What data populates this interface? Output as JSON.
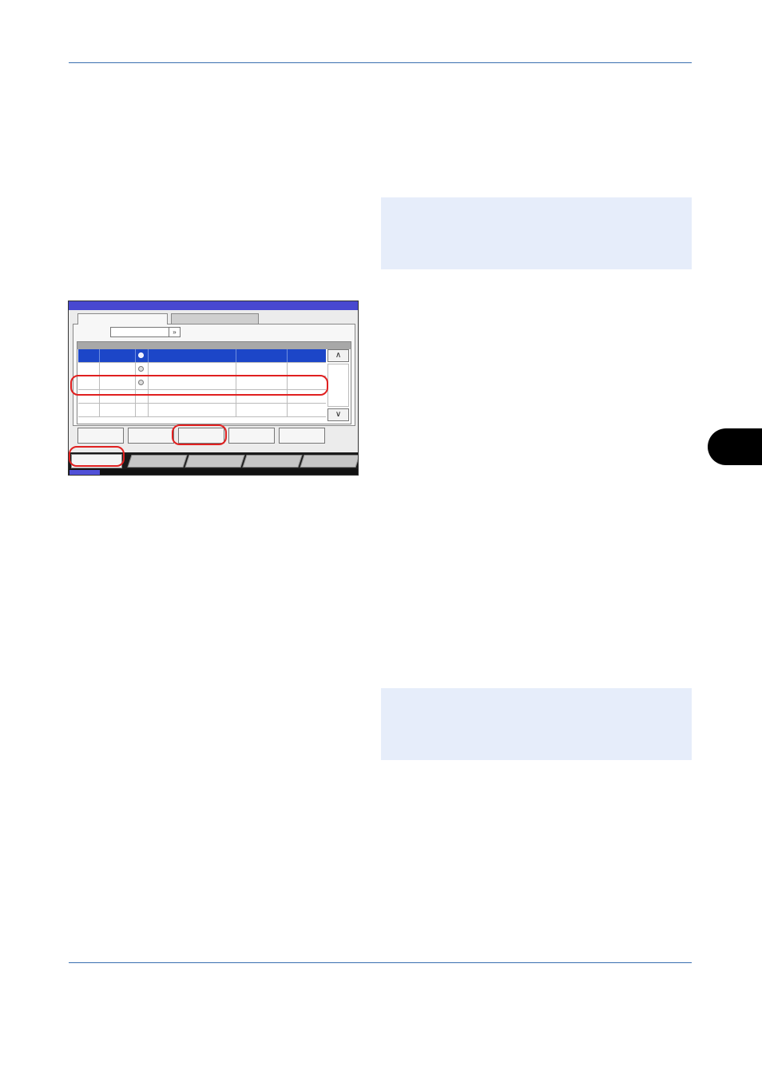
{
  "colors": {
    "rule": "#3a6fb0",
    "note_background": "#e6edfa",
    "panel_titlebar": "#4848d0",
    "selected_row": "#1c46c8",
    "highlight": "#e02020",
    "chapter_tab": "#000000"
  },
  "panel": {
    "list_rows": [
      {
        "selected": true,
        "icon": "document-icon"
      },
      {
        "selected": false,
        "icon": "document-icon"
      },
      {
        "selected": false,
        "icon": "document-icon",
        "highlighted": true
      },
      {
        "selected": false,
        "icon": ""
      },
      {
        "selected": false,
        "icon": ""
      }
    ],
    "scroll_up_icon": "chevron-up-icon",
    "scroll_down_icon": "chevron-down-icon",
    "dropdown_icon": "double-chevron-down-icon",
    "function_buttons": 5,
    "bottom_tabs": 5
  }
}
